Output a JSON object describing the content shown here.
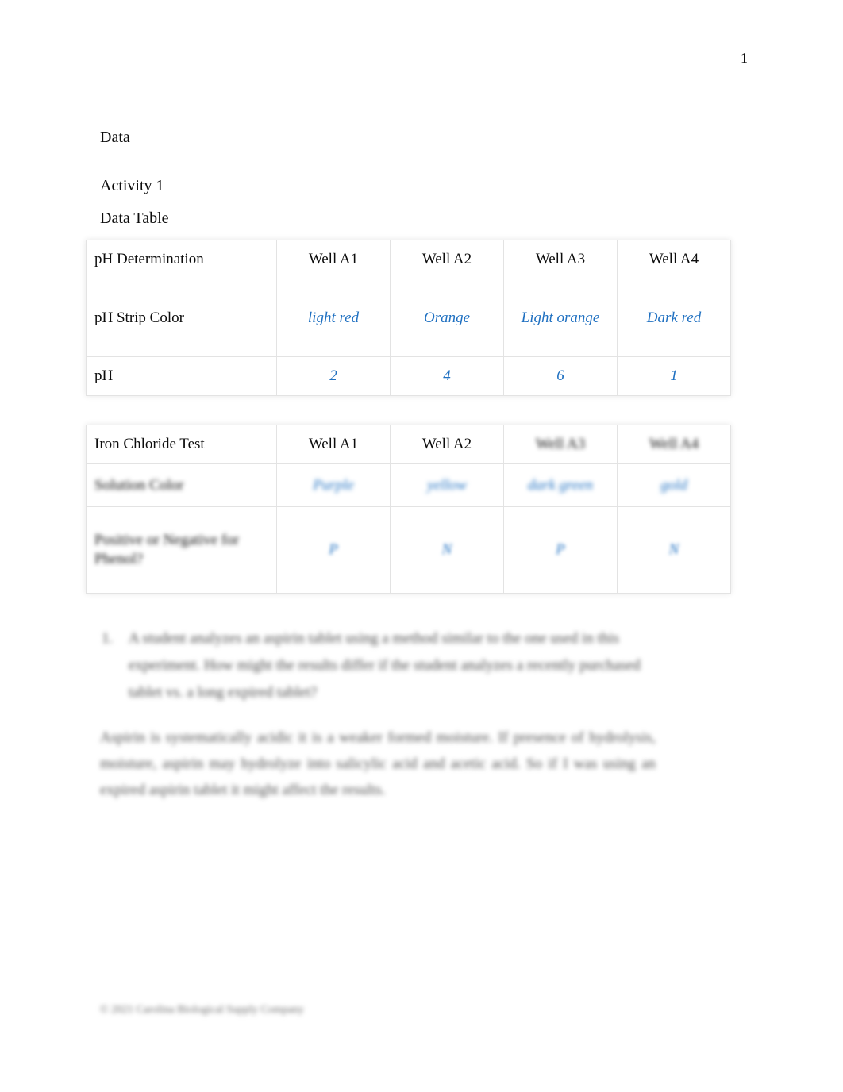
{
  "document": {
    "page_number": "1",
    "headings": {
      "data": "Data",
      "activity": "Activity 1",
      "data_table": "Data Table"
    },
    "footer": "© 2021 Carolina Biological Supply Company"
  },
  "colors": {
    "answer_blue": "#1f70c1",
    "text_black": "#0d0d0d",
    "table_border": "#e3e3e3"
  },
  "ph_table": {
    "row_header_label": "pH Determination",
    "columns": [
      "Well A1",
      "Well A2",
      "Well A3",
      "Well A4"
    ],
    "rows": [
      {
        "label": "pH Strip Color",
        "values": [
          "light red",
          "Orange",
          "Light orange",
          "Dark red"
        ]
      },
      {
        "label": "pH",
        "values": [
          "2",
          "4",
          "6",
          "1"
        ]
      }
    ]
  },
  "iron_table": {
    "row_header_label": "Iron Chloride Test",
    "columns": [
      "Well A1",
      "Well A2",
      "Well A3",
      "Well A4"
    ],
    "rows": [
      {
        "label": "Solution Color",
        "values": [
          "Purple",
          "yellow",
          "dark green",
          "gold"
        ]
      },
      {
        "label": "Positive or Negative for Phenol?",
        "values": [
          "P",
          "N",
          "P",
          "N"
        ]
      }
    ]
  },
  "question": {
    "number": "1.",
    "text": "A student analyzes an aspirin tablet using a method similar to the one used in this experiment. How might the results differ if the student analyzes a recently purchased tablet vs. a long expired tablet?",
    "answer": "Aspirin is systematically acidic it is a weaker formed moisture. If presence of hydrolysis, moisture, aspirin may hydrolyze into salicylic acid and acetic acid. So if I was using an expired aspirin tablet it might affect the results."
  }
}
